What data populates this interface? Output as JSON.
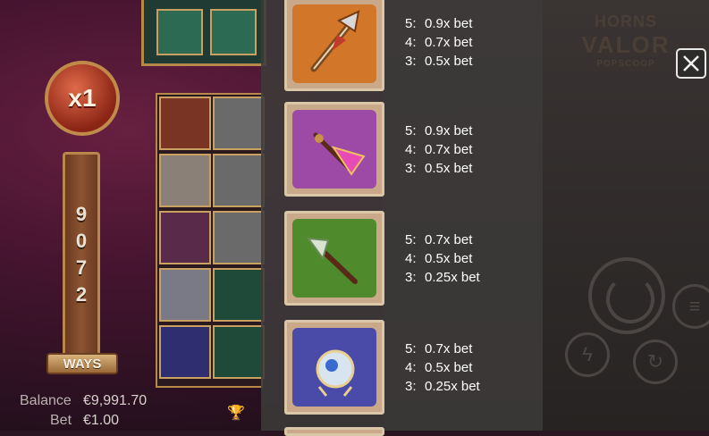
{
  "game": {
    "multiplier": "x1",
    "ways_digits": [
      "9",
      "0",
      "7",
      "2"
    ],
    "ways_label": "WAYS",
    "logo": {
      "line1": "HORNS",
      "line2": "VALOR",
      "line3": "POPSCOOP"
    }
  },
  "footer": {
    "balance_label": "Balance",
    "balance_value": "€9,991.70",
    "bet_label": "Bet",
    "bet_value": "€1.00"
  },
  "paytable": {
    "rows": [
      {
        "symbol": "axe-symbol",
        "bg": "#d2762a",
        "pays": [
          {
            "n": "5:",
            "v": "0.9x bet"
          },
          {
            "n": "4:",
            "v": "0.7x bet"
          },
          {
            "n": "3:",
            "v": "0.5x bet"
          }
        ]
      },
      {
        "symbol": "purple-arrow-symbol",
        "bg": "#9c4aa6",
        "pays": [
          {
            "n": "5:",
            "v": "0.9x bet"
          },
          {
            "n": "4:",
            "v": "0.7x bet"
          },
          {
            "n": "3:",
            "v": "0.5x bet"
          }
        ]
      },
      {
        "symbol": "green-spear-symbol",
        "bg": "#4f8a2c",
        "pays": [
          {
            "n": "5:",
            "v": "0.7x bet"
          },
          {
            "n": "4:",
            "v": "0.5x bet"
          },
          {
            "n": "3:",
            "v": "0.25x bet"
          }
        ]
      },
      {
        "symbol": "blue-orb-symbol",
        "bg": "#4a4aa8",
        "pays": [
          {
            "n": "5:",
            "v": "0.7x bet"
          },
          {
            "n": "4:",
            "v": "0.5x bet"
          },
          {
            "n": "3:",
            "v": "0.25x bet"
          }
        ]
      }
    ]
  },
  "close_icon": "close-icon"
}
